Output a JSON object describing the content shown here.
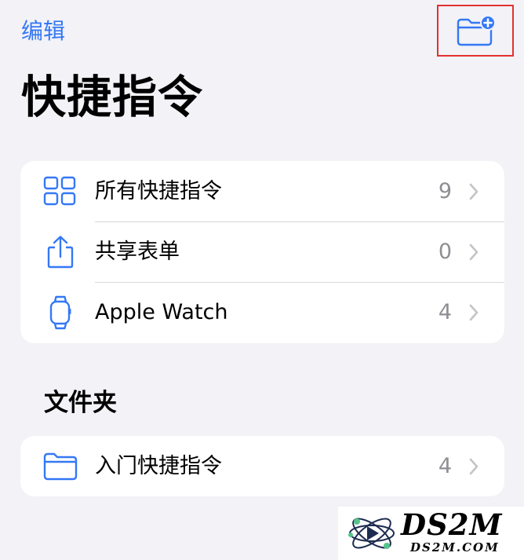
{
  "header": {
    "edit_label": "编辑",
    "title": "快捷指令"
  },
  "main_list": [
    {
      "label": "所有快捷指令",
      "count": "9",
      "icon": "grid-icon"
    },
    {
      "label": "共享表单",
      "count": "0",
      "icon": "share-icon"
    },
    {
      "label": "Apple Watch",
      "count": "4",
      "icon": "watch-icon"
    }
  ],
  "folders": {
    "header": "文件夹",
    "items": [
      {
        "label": "入门快捷指令",
        "count": "4",
        "icon": "folder-icon"
      }
    ]
  },
  "watermark": {
    "text": "DS2M",
    "sub": "DS2M.COM"
  },
  "colors": {
    "accent": "#3478f6",
    "background": "#f2f2f7",
    "highlight_box": "#e2322f",
    "secondary_text": "#8e8e93"
  }
}
